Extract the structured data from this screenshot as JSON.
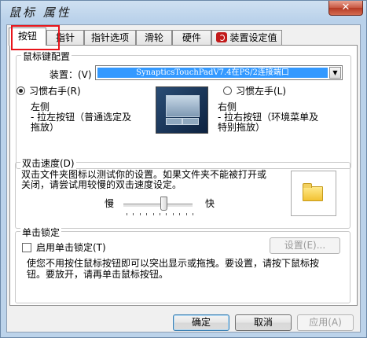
{
  "window": {
    "title": "鼠标 属性",
    "close_label": "✕"
  },
  "tabs": [
    {
      "label": "按钮",
      "active": true
    },
    {
      "label": "指针"
    },
    {
      "label": "指针选项"
    },
    {
      "label": "滑轮"
    },
    {
      "label": "硬件"
    },
    {
      "label": "装置设定值",
      "icon": "synaptics-icon"
    }
  ],
  "mouse_key_config": {
    "group_label": "鼠标键配置",
    "device_label": "装置：(V)",
    "device_value": "SynapticsTouchPadV7.4在PS/2连接端口",
    "right_handed_label": "习惯右手(R)",
    "left_handed_label": "习惯左手(L)",
    "left_heading": "左侧",
    "left_desc_1": "- 拉左按钮（普通选定及",
    "left_desc_2": "拖放）",
    "right_heading": "右侧",
    "right_desc_1": "- 拉右按钮（环境菜单及",
    "right_desc_2": "特别拖放）"
  },
  "double_click": {
    "group_label": "双击速度(D)",
    "desc_1": "双击文件夹图标以测试你的设置。如果文件夹不能被打开或",
    "desc_2": "关闭，请尝试用较慢的双击速度设定。",
    "slow_label": "慢",
    "fast_label": "快",
    "speed_level": 0.58
  },
  "click_lock": {
    "group_label": "单击锁定",
    "checkbox_label": "启用单击锁定(T)",
    "checked": false,
    "settings_button": "设置(E)...",
    "desc_1": "使您不用按住鼠标按钮即可以突出显示或拖拽。要设置，请按下鼠标按",
    "desc_2": "钮。要放开，请再单击鼠标按钮。"
  },
  "footer": {
    "ok": "确定",
    "cancel": "取消",
    "apply": "应用(A)"
  },
  "colors": {
    "highlight_box": "#e8141a",
    "selection": "#3399ff"
  }
}
